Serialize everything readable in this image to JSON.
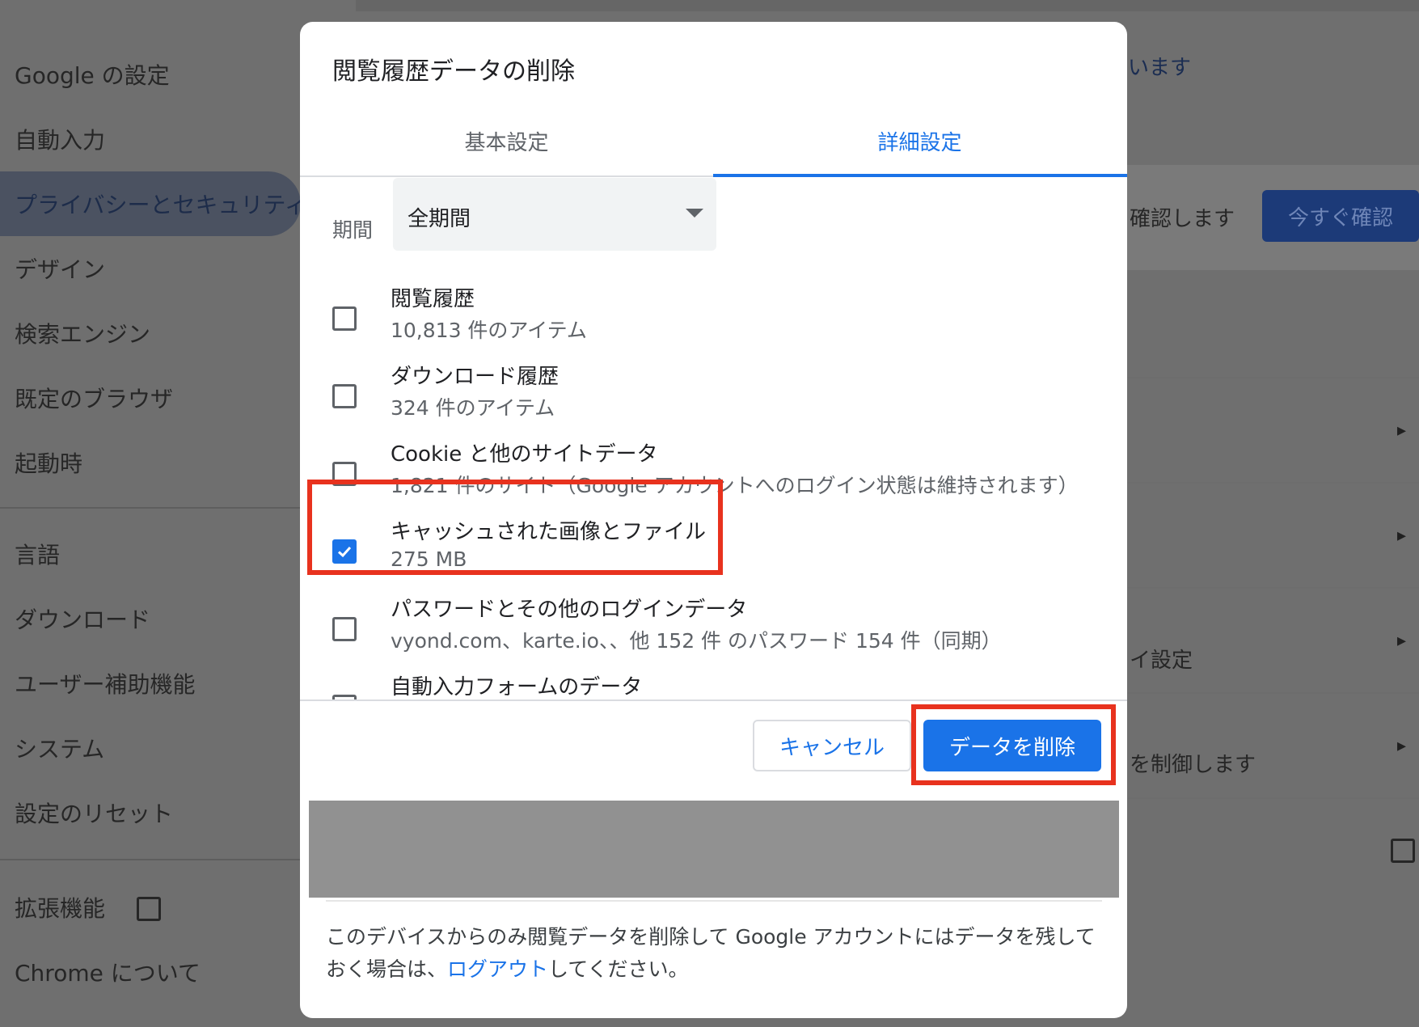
{
  "background": {
    "nav": {
      "google_settings": "Google の設定",
      "autofill": "自動入力",
      "privacy_security": "プライバシーとセキュリティ",
      "design": "デザイン",
      "search_engine": "検索エンジン",
      "default_browser": "既定のブラウザ",
      "on_startup": "起動時",
      "languages": "言語",
      "downloads": "ダウンロード",
      "accessibility": "ユーザー補助機能",
      "system": "システム",
      "reset_settings": "設定のリセット",
      "extensions": "拡張機能",
      "about_chrome": "Chrome について"
    },
    "right": {
      "top_link": "います",
      "confirm_text": "確認します",
      "check_now_button": "今すぐ確認",
      "settings_text": "イ設定",
      "control_text": "を制御します"
    }
  },
  "dialog": {
    "title": "閲覧履歴データの削除",
    "tabs": {
      "basic": "基本設定",
      "advanced": "詳細設定"
    },
    "period": {
      "label": "期間",
      "value": "全期間"
    },
    "items": [
      {
        "title": "閲覧履歴",
        "subtitle": "10,813 件のアイテム",
        "checked": false
      },
      {
        "title": "ダウンロード履歴",
        "subtitle": "324 件のアイテム",
        "checked": false
      },
      {
        "title": "Cookie と他のサイトデータ",
        "subtitle": "1,821 件のサイト（Google アカウントへのログイン状態は維持されます）",
        "checked": false
      },
      {
        "title": "キャッシュされた画像とファイル",
        "subtitle": "275 MB",
        "checked": true
      },
      {
        "title": "パスワードとその他のログインデータ",
        "subtitle": "vyond.com、karte.io、、他 152 件 のパスワード 154 件（同期）",
        "checked": false
      },
      {
        "title": "自動入力フォームのデータ",
        "subtitle": "",
        "checked": false
      }
    ],
    "buttons": {
      "cancel": "キャンセル",
      "delete": "データを削除"
    },
    "footer": {
      "text_before": "このデバイスからのみ閲覧データを削除して Google アカウントにはデータを残しておく場合は、",
      "link": "ログアウト",
      "text_after": "してください。"
    }
  },
  "colors": {
    "accent": "#1a73e8",
    "highlight": "#e8321e"
  }
}
